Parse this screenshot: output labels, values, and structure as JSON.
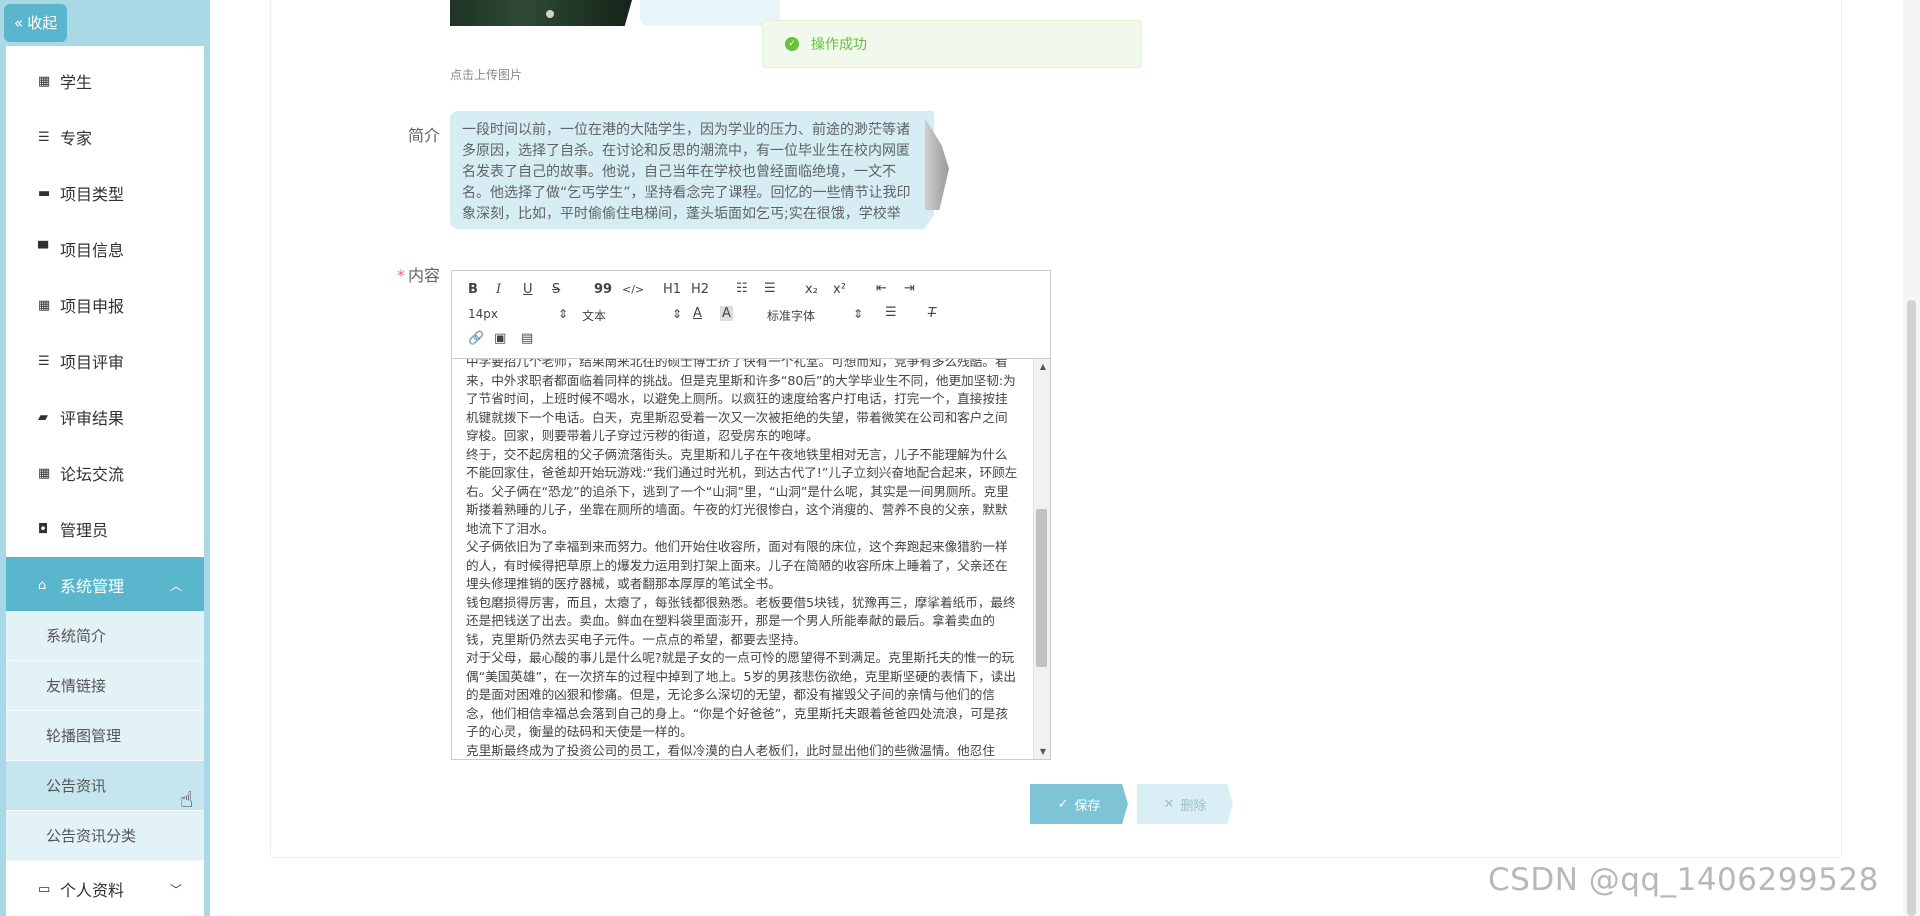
{
  "sidebar": {
    "collapse_label": "收起",
    "items": [
      {
        "label": "学生",
        "icon": "grid-icon"
      },
      {
        "label": "专家",
        "icon": "list-icon"
      },
      {
        "label": "项目类型",
        "icon": "briefcase-icon"
      },
      {
        "label": "项目信息",
        "icon": "monitor-icon"
      },
      {
        "label": "项目申报",
        "icon": "grid-icon"
      },
      {
        "label": "项目评审",
        "icon": "list-icon"
      },
      {
        "label": "评审结果",
        "icon": "comment-icon"
      },
      {
        "label": "论坛交流",
        "icon": "grid-icon"
      },
      {
        "label": "管理员",
        "icon": "clipboard-icon"
      }
    ],
    "system": {
      "label": "系统管理",
      "icon": "home-icon",
      "children": [
        "系统简介",
        "友情链接",
        "轮播图管理",
        "公告资讯",
        "公告资讯分类"
      ]
    },
    "profile": {
      "label": "个人资料",
      "icon": "card-icon"
    }
  },
  "toast": {
    "message": "操作成功"
  },
  "form": {
    "upload_hint": "点击上传图片",
    "intro_label": "简介",
    "intro_text": "一段时间以前，一位在港的大陆学生，因为学业的压力、前途的渺茫等诸多原因，选择了自杀。在讨论和反思的潮流中，有一位毕业生在校内网匿名发表了自己的故事。他说，自己当年在学校也曾经面临绝境，一文不名。他选择了做“乞丐学生”，坚持看念完了课程。回忆的一些情节让我印象深刻，比如，平时偷偷住电梯间，蓬头垢面如乞丐;实在很饿，学校举",
    "content_label": "内容",
    "required_mark": "*",
    "save_label": "保存",
    "delete_label": "删除"
  },
  "editor": {
    "toolbar": {
      "bold": "B",
      "italic": "I",
      "underline": "U",
      "strike": "S",
      "quote": "99",
      "code": "</>",
      "h1": "H1",
      "h2": "H2",
      "sub": "x₂",
      "sup": "x²",
      "size": "14px",
      "header": "文本",
      "font": "标准字体"
    },
    "paragraphs": [
      "中学要招几个老师，结果南来北往的硕士博士挤了快有一个礼堂。可想而知，竞争有多么残酷。看来，中外求职者都面临着同样的挑战。但是克里斯和许多“80后”的大学毕业生不同，他更加坚韧:为了节省时间，上班时候不喝水，以避免上厕所。以疯狂的速度给客户打电话，打完一个，直接按挂机键就拨下一个电话。白天，克里斯忍受着一次又一次被拒绝的失望，带着微笑在公司和客户之间穿梭。回家，则要带着儿子穿过污秽的街道，忍受房东的咆哮。",
      "终于，交不起房租的父子俩流落街头。克里斯和儿子在午夜地铁里相对无言，儿子不能理解为什么不能回家住，爸爸却开始玩游戏:“我们通过时光机，到达古代了!”儿子立刻兴奋地配合起来，环顾左右。父子俩在“恐龙”的追杀下，逃到了一个“山洞”里，“山洞”是什么呢，其实是一间男厕所。克里斯搂着熟睡的儿子，坐靠在厕所的墙面。午夜的灯光很惨白，这个消瘦的、营养不良的父亲，默默地流下了泪水。",
      "父子俩依旧为了幸福到来而努力。他们开始住收容所，面对有限的床位，这个奔跑起来像猎豹一样的人，有时候得把草原上的爆发力运用到打架上面来。儿子在简陋的收容所床上睡着了，父亲还在埋头修理推销的医疗器械，或者翻那本厚厚的笔试全书。",
      "钱包磨损得厉害，而且，太瘪了，每张钱都很熟悉。老板要借5块钱，犹豫再三，摩挲着纸币，最终还是把钱送了出去。卖血。鲜血在塑料袋里面澎开，那是一个男人所能奉献的最后。拿着卖血的钱，克里斯仍然去买电子元件。一点点的希望，都要去坚持。",
      "对于父母，最心酸的事儿是什么呢?就是子女的一点可怜的愿望得不到满足。克里斯托夫的惟一的玩偶“美国英雄”，在一次挤车的过程中掉到了地上。5岁的男孩悲伤欲绝，克里斯坚硬的表情下，读出的是面对困难的凶狠和惨痛。但是，无论多么深切的无望，都没有摧毁父子间的亲情与他们的信念，他们相信幸福总会落到自己的身上。“你是个好爸爸”，克里斯托夫跟着爸爸四处流浪，可是孩子的心灵，衡量的砝码和天使是一样的。",
      "克里斯最终成为了投资公司的员工，看似冷漠的白人老板们，此时显出他们的些微温情。他忍住"
    ]
  },
  "watermark": "CSDN @qq_1406299528"
}
